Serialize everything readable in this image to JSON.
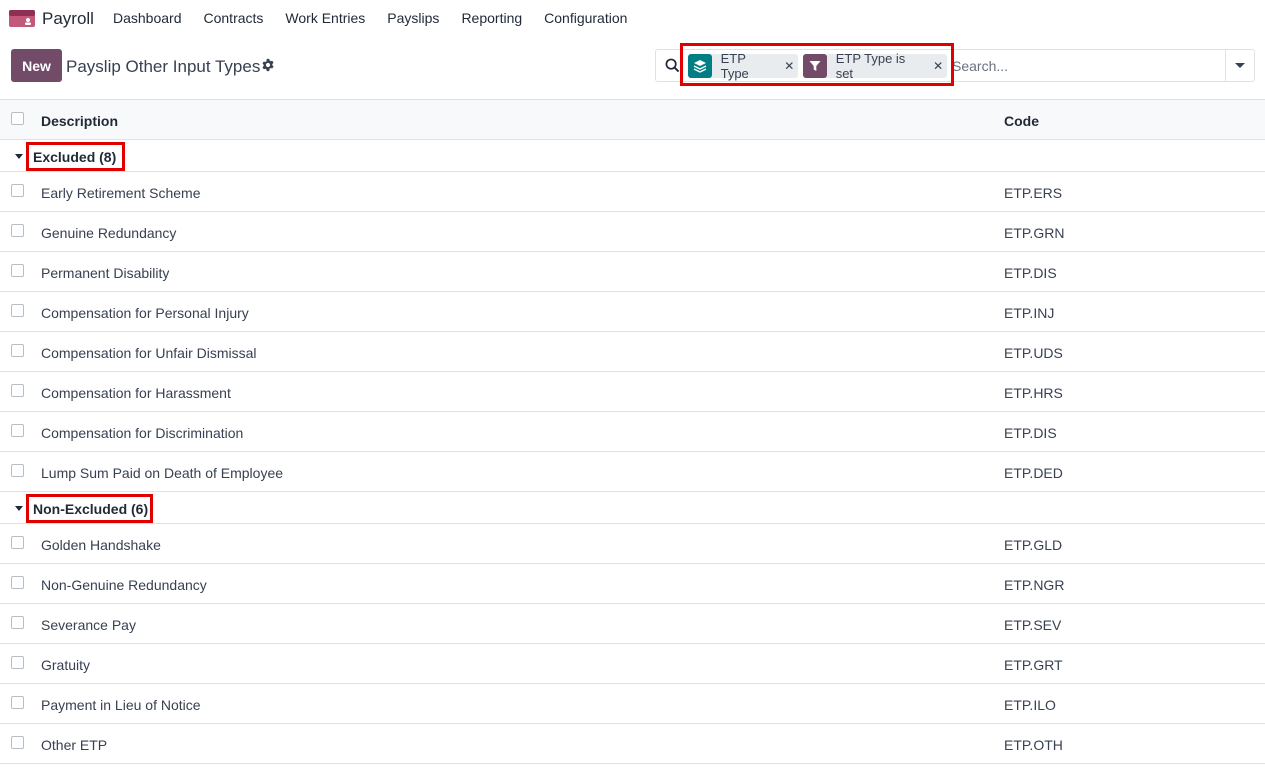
{
  "navbar": {
    "app_name": "Payroll",
    "menu": [
      "Dashboard",
      "Contracts",
      "Work Entries",
      "Payslips",
      "Reporting",
      "Configuration"
    ]
  },
  "control_panel": {
    "new_label": "New",
    "title": "Payslip Other Input Types",
    "search": {
      "facets": [
        {
          "type": "groupby",
          "label": "ETP Type",
          "color": "#017e84"
        },
        {
          "type": "filter",
          "label": "ETP Type is set",
          "color": "#714b67"
        }
      ],
      "placeholder": "Search..."
    }
  },
  "list": {
    "columns": [
      "Description",
      "Code"
    ],
    "groups": [
      {
        "label": "Excluded (8)",
        "rows": [
          {
            "description": "Early Retirement Scheme",
            "code": "ETP.ERS"
          },
          {
            "description": "Genuine Redundancy",
            "code": "ETP.GRN"
          },
          {
            "description": "Permanent Disability",
            "code": "ETP.DIS"
          },
          {
            "description": "Compensation for Personal Injury",
            "code": "ETP.INJ"
          },
          {
            "description": "Compensation for Unfair Dismissal",
            "code": "ETP.UDS"
          },
          {
            "description": "Compensation for Harassment",
            "code": "ETP.HRS"
          },
          {
            "description": "Compensation for Discrimination",
            "code": "ETP.DIS"
          },
          {
            "description": "Lump Sum Paid on Death of Employee",
            "code": "ETP.DED"
          }
        ]
      },
      {
        "label": "Non-Excluded (6)",
        "rows": [
          {
            "description": "Golden Handshake",
            "code": "ETP.GLD"
          },
          {
            "description": "Non-Genuine Redundancy",
            "code": "ETP.NGR"
          },
          {
            "description": "Severance Pay",
            "code": "ETP.SEV"
          },
          {
            "description": "Gratuity",
            "code": "ETP.GRT"
          },
          {
            "description": "Payment in Lieu of Notice",
            "code": "ETP.ILO"
          },
          {
            "description": "Other ETP",
            "code": "ETP.OTH"
          }
        ]
      }
    ]
  },
  "colors": {
    "brand": "#714b67",
    "groupby_facet": "#017e84",
    "highlight": "#e00000"
  }
}
